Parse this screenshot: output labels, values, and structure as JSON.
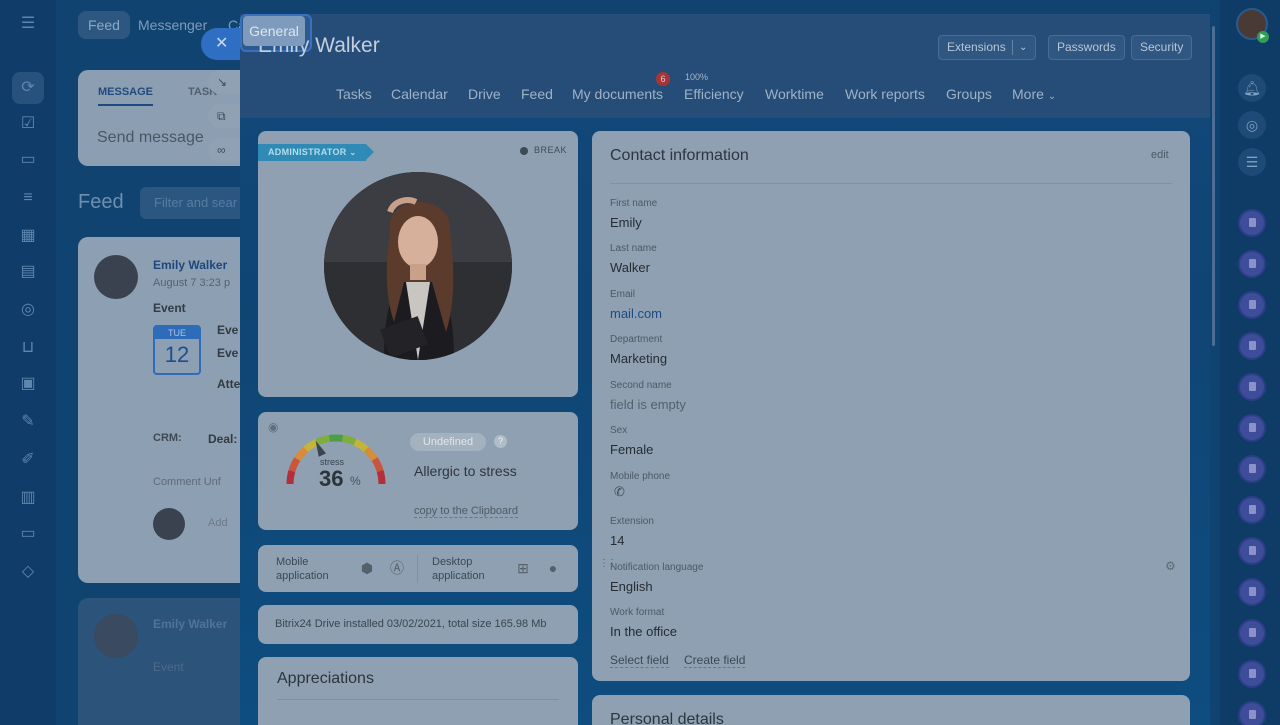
{
  "background": {
    "tabs": [
      "Feed",
      "Messenger",
      "Ca"
    ],
    "message_card": {
      "tab_message": "MESSAGE",
      "tab_tasks": "TASK",
      "placeholder": "Send message"
    },
    "feed_title": "Feed",
    "filter_placeholder": "Filter and sear",
    "post": {
      "author": "Emily Walker",
      "date": "August 7 3:23 p",
      "type": "Event",
      "day_name": "TUE",
      "day_num": "12",
      "crm_label": "CRM:",
      "crm_value": "Deal:",
      "comment": "Comment   Unf",
      "add_comment": "Add",
      "ev1": "Eve",
      "ev2": "Eve",
      "att": "Atte"
    },
    "post2": {
      "author": "Emily Walker",
      "type": "Event"
    }
  },
  "slider": {
    "title": "Emily Walker",
    "header_buttons": {
      "extensions": "Extensions",
      "passwords": "Passwords",
      "security": "Security"
    },
    "tabs": [
      "General",
      "Tasks",
      "Calendar",
      "Drive",
      "Feed",
      "My documents",
      "Efficiency",
      "Worktime",
      "Work reports",
      "Groups",
      "More"
    ],
    "docs_badge": "6",
    "efficiency_pct": "100%"
  },
  "profile": {
    "role_badge": "ADMINISTRATOR",
    "status": "BREAK"
  },
  "stress": {
    "label": "stress",
    "value": "36",
    "unit": "%",
    "level": 0.36,
    "badge": "Undefined",
    "help": "?",
    "description": "Allergic to stress",
    "copy_link": "copy to the Clipboard"
  },
  "apps": {
    "mobile_line1": "Mobile",
    "mobile_line2": "application",
    "desktop_line1": "Desktop",
    "desktop_line2": "application"
  },
  "drive_info": "Bitrix24 Drive installed 03/02/2021, total size 165.98 Mb",
  "appreciations_title": "Appreciations",
  "contact": {
    "title": "Contact information",
    "edit": "edit",
    "fields": [
      {
        "label": "First name",
        "value": "Emily"
      },
      {
        "label": "Last name",
        "value": "Walker"
      },
      {
        "label": "Email",
        "value": "mail.com"
      },
      {
        "label": "Department",
        "value": "Marketing"
      },
      {
        "label": "Second name",
        "value": "field is empty"
      },
      {
        "label": "Sex",
        "value": "Female"
      },
      {
        "label": "Mobile phone",
        "value": ""
      },
      {
        "label": "Extension",
        "value": "14"
      },
      {
        "label": "Notification language",
        "value": "English"
      },
      {
        "label": "Work format",
        "value": "In the office"
      }
    ],
    "select_field": "Select field",
    "create_field": "Create field"
  },
  "personal_title": "Personal details",
  "colors": {
    "accent": "#2e6fc4",
    "badge": "#2f8bb5",
    "notification": "#a63537"
  }
}
